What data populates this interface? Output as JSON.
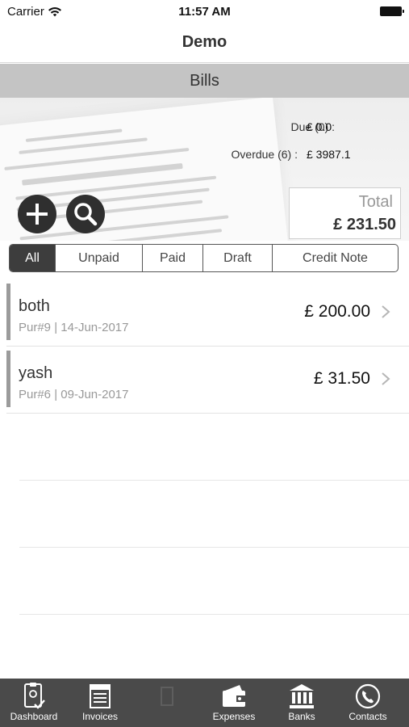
{
  "status_bar": {
    "carrier": "Carrier",
    "time": "11:57 AM"
  },
  "nav": {
    "title": "Demo"
  },
  "section": {
    "title": "Bills"
  },
  "summary": {
    "due_label": "Due (0) :",
    "due_value": "£ 0.0",
    "overdue_label": "Overdue (6) :",
    "overdue_value": "£ 3987.1",
    "total_label": "Total",
    "total_value": "£ 231.50"
  },
  "filters": [
    "All",
    "Unpaid",
    "Paid",
    "Draft",
    "Credit Note"
  ],
  "bills": [
    {
      "name": "both",
      "meta": "Pur#9 | 14-Jun-2017",
      "amount": "£ 200.00"
    },
    {
      "name": "yash",
      "meta": "Pur#6 | 09-Jun-2017",
      "amount": "£ 31.50"
    }
  ],
  "tabs": [
    {
      "label": "Dashboard",
      "icon": "dashboard-icon"
    },
    {
      "label": "Invoices",
      "icon": "invoices-icon"
    },
    {
      "label": "",
      "icon": "bills-icon"
    },
    {
      "label": "Expenses",
      "icon": "expenses-icon"
    },
    {
      "label": "Banks",
      "icon": "banks-icon"
    },
    {
      "label": "Contacts",
      "icon": "contacts-icon"
    }
  ],
  "colors": {
    "accent": "#3d3d3d",
    "tab_bar": "#4a4a4a",
    "section_bar": "#c4c4c4"
  }
}
